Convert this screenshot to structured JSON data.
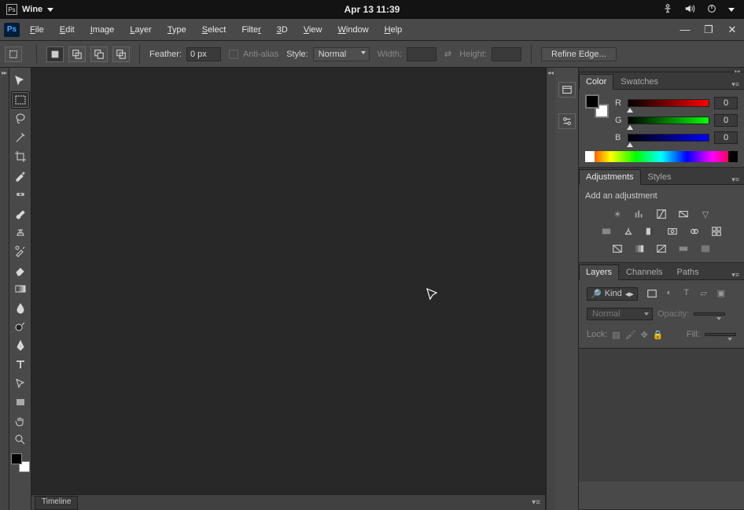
{
  "os": {
    "app_name": "Wine",
    "clock": "Apr 13  11:39"
  },
  "menus": [
    "File",
    "Edit",
    "Image",
    "Layer",
    "Type",
    "Select",
    "Filter",
    "3D",
    "View",
    "Window",
    "Help"
  ],
  "options": {
    "feather_label": "Feather:",
    "feather_value": "0 px",
    "antialias_label": "Anti-alias",
    "style_label": "Style:",
    "style_value": "Normal",
    "width_label": "Width:",
    "height_label": "Height:",
    "refine_label": "Refine Edge..."
  },
  "timeline_tab": "Timeline",
  "panels": {
    "color": {
      "tab_color": "Color",
      "tab_swatches": "Swatches",
      "r_label": "R",
      "g_label": "G",
      "b_label": "B",
      "r_value": "0",
      "g_value": "0",
      "b_value": "0"
    },
    "adjust": {
      "tab_adjust": "Adjustments",
      "tab_styles": "Styles",
      "title": "Add an adjustment"
    },
    "layers": {
      "tab_layers": "Layers",
      "tab_channels": "Channels",
      "tab_paths": "Paths",
      "kind_label": "Kind",
      "blend_value": "Normal",
      "opacity_label": "Opacity:",
      "lock_label": "Lock:",
      "fill_label": "Fill:"
    }
  }
}
